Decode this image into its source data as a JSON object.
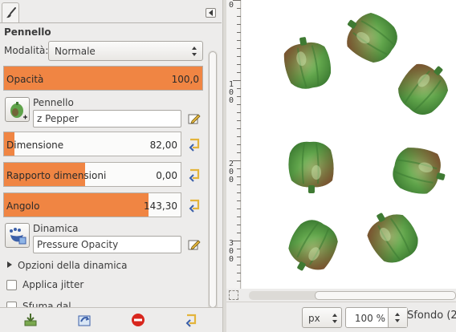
{
  "dock": {
    "title": "Pennello",
    "mode_label": "Modalità:",
    "mode_value": "Normale",
    "opacity": {
      "label": "Opacità",
      "value": "100,0",
      "fraction": 1.0
    },
    "brush": {
      "label": "Pennello",
      "value": "z Pepper"
    },
    "size": {
      "label": "Dimensione",
      "value": "82,00",
      "fraction": 0.06
    },
    "aspect": {
      "label": "Rapporto dimensioni",
      "value": "0,00",
      "fraction": 0.46
    },
    "angle": {
      "label": "Angolo",
      "value": "143,30",
      "fraction": 0.82
    },
    "dynamics": {
      "label": "Dinamica",
      "value": "Pressure Opacity"
    },
    "dynamics_options": "Opzioni della dinamica",
    "jitter": "Applica jitter",
    "partial": "Sfuma dal..."
  },
  "canvas": {
    "ruler_labels": [
      "0",
      "100",
      "200",
      "300"
    ],
    "unit": "px",
    "zoom": "100 %",
    "layer": "Sfondo (2"
  },
  "colors": {
    "slider_fill": "#f08543",
    "pepper_green": "#5fa34a",
    "pepper_red": "#8a3a2a"
  }
}
